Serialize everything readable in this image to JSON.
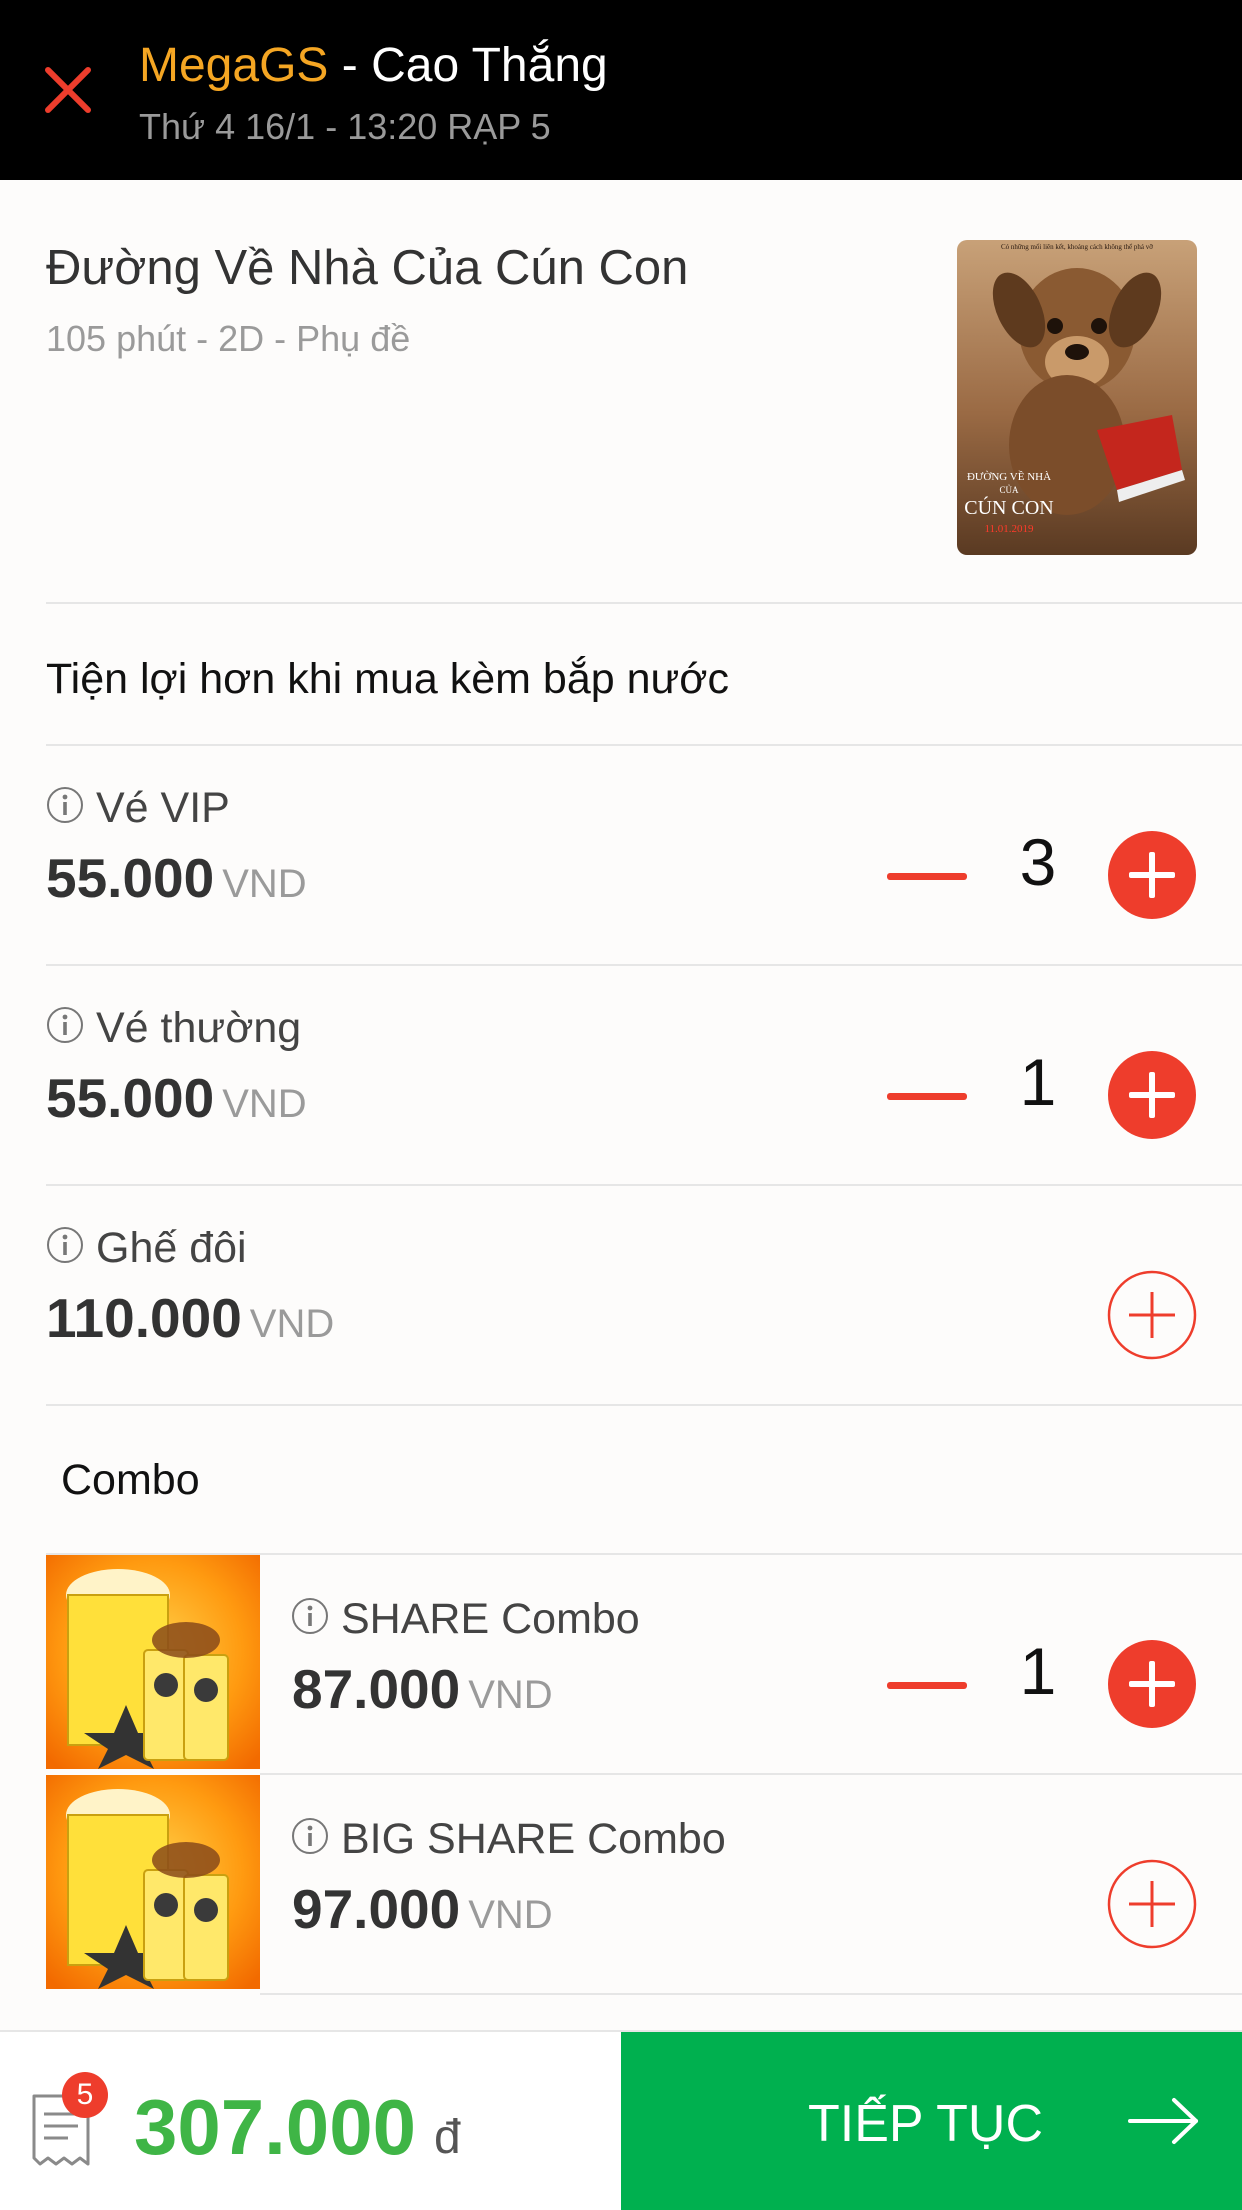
{
  "header": {
    "cinema_brand": "MegaGS",
    "cinema_branch": " - Cao Thắng",
    "showtime": "Thứ 4 16/1 - 13:20 RẠP 5"
  },
  "movie": {
    "title": "Đường Về Nhà Của Cún Con",
    "meta": "105 phút - 2D - Phụ đề",
    "poster": {
      "top_text": "Có những mối liên kết, khoảng cách không thể phá vỡ",
      "title_line1": "ĐƯỜNG VỀ NHÀ",
      "title_line2": "CỦA",
      "title_line3": "CÚN CON",
      "date": "11.01.2019"
    }
  },
  "tickets_section": {
    "title": "Tiện lợi hơn khi mua kèm bắp nước"
  },
  "tickets": [
    {
      "name": "Vé VIP",
      "price": "55.000",
      "unit": "VND",
      "qty": "3"
    },
    {
      "name": "Vé thường",
      "price": "55.000",
      "unit": "VND",
      "qty": "1"
    },
    {
      "name": "Ghế đôi",
      "price": "110.000",
      "unit": "VND",
      "qty": ""
    }
  ],
  "combo_section": {
    "title": "Combo"
  },
  "combos": [
    {
      "name": "SHARE Combo",
      "price": "87.000",
      "unit": "VND",
      "qty": "1"
    },
    {
      "name": "BIG SHARE Combo",
      "price": "97.000",
      "unit": "VND",
      "qty": ""
    }
  ],
  "footer": {
    "cart_count": "5",
    "total": "307.000",
    "currency": "đ",
    "continue_label": "TIẾP TỤC"
  },
  "colors": {
    "accent_red": "#ee3d2c",
    "brand_orange": "#f5a623",
    "total_green": "#3fb546",
    "button_green": "#00b04f"
  }
}
